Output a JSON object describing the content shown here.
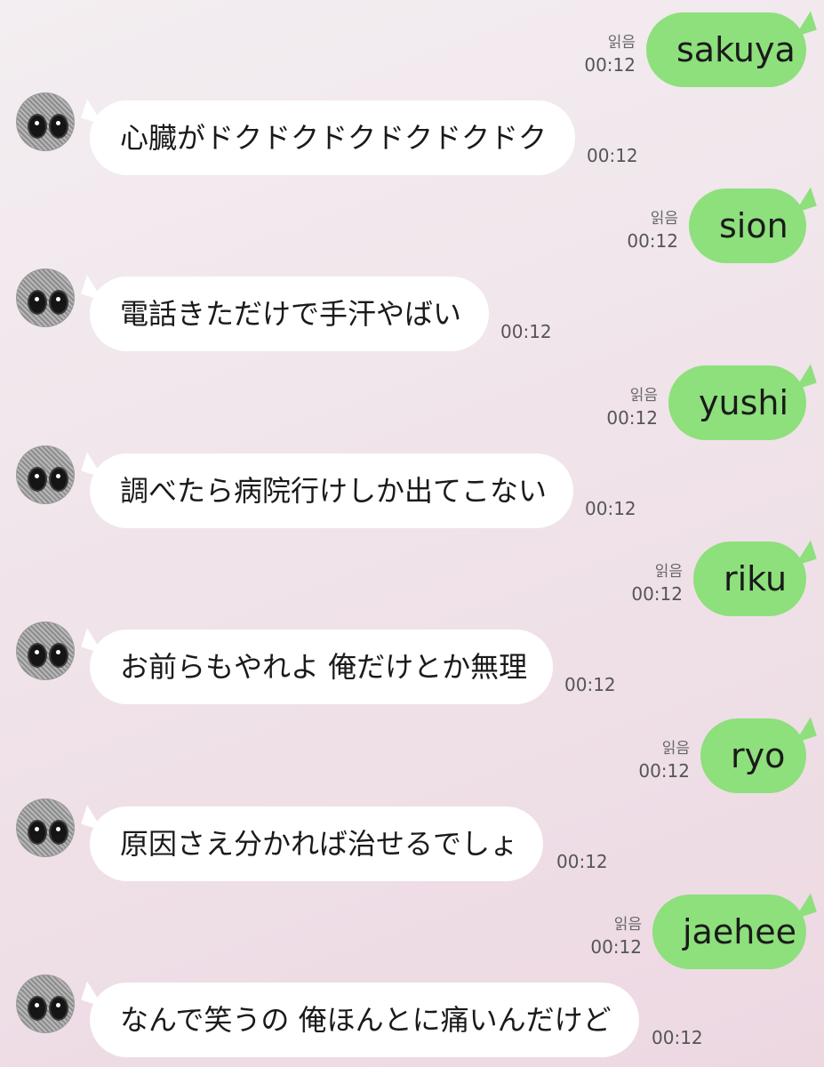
{
  "chat": {
    "read_label": "읽음",
    "messages": [
      {
        "direction": "out",
        "text": "sakuya",
        "time": "00:12"
      },
      {
        "direction": "in",
        "text": "心臓がドクドクドクドクドクドク",
        "time": "00:12"
      },
      {
        "direction": "out",
        "text": "sion",
        "time": "00:12"
      },
      {
        "direction": "in",
        "text": "電話きただけで手汗やばい",
        "time": "00:12"
      },
      {
        "direction": "out",
        "text": "yushi",
        "time": "00:12"
      },
      {
        "direction": "in",
        "text": "調べたら病院行けしか出てこない",
        "time": "00:12"
      },
      {
        "direction": "out",
        "text": "riku",
        "time": "00:12"
      },
      {
        "direction": "in",
        "text": "お前らもやれよ 俺だけとか無理",
        "time": "00:12"
      },
      {
        "direction": "out",
        "text": "ryo",
        "time": "00:12"
      },
      {
        "direction": "in",
        "text": "原因さえ分かれば治せるでしょ",
        "time": "00:12"
      },
      {
        "direction": "out",
        "text": "jaehee",
        "time": "00:12"
      },
      {
        "direction": "in",
        "text": "なんで笑うの 俺ほんとに痛いんだけど",
        "time": "00:12"
      }
    ]
  },
  "colors": {
    "outgoing_bubble": "#8de07b",
    "incoming_bubble": "#ffffff",
    "background_top": "#f3eef1",
    "background_bottom": "#edd8e2"
  },
  "icons": {
    "avatar": "avatar-icon"
  }
}
